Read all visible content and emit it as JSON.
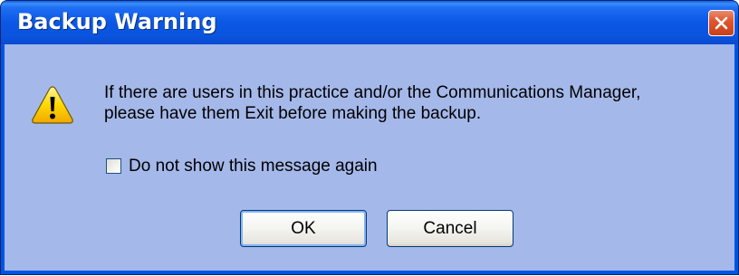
{
  "window": {
    "title": "Backup Warning"
  },
  "icons": {
    "warning": "warning-icon",
    "close": "close-icon"
  },
  "message": {
    "line1": "If there are users in this practice and/or the Communications Manager,",
    "line2": "please have them Exit before making the backup."
  },
  "checkbox": {
    "label": "Do not show this message again",
    "checked": false
  },
  "buttons": {
    "ok_label": "OK",
    "cancel_label": "Cancel"
  },
  "colors": {
    "title_bar": "#0a54df",
    "client_area": "#a5b8ea",
    "close_button": "#e0562f"
  }
}
